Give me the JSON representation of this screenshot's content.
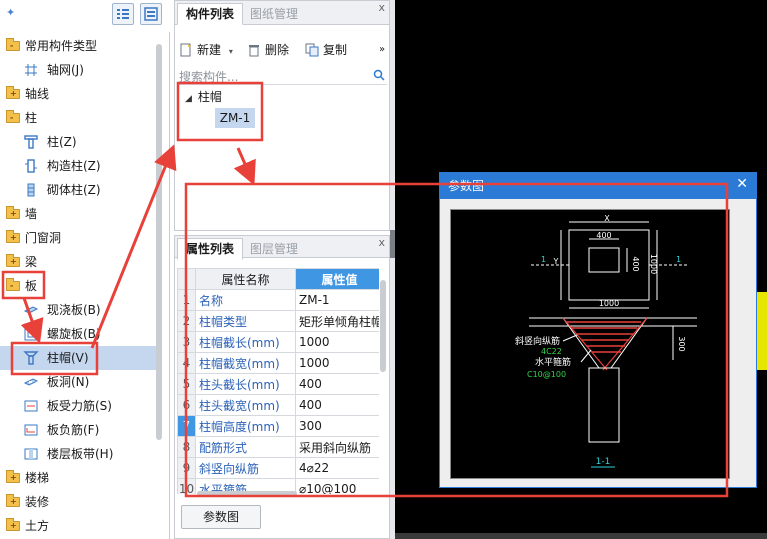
{
  "left_tree": {
    "items": [
      {
        "label": "常用构件类型",
        "kind": "folder",
        "mark": "-"
      },
      {
        "label": "轴网(J)",
        "kind": "child",
        "icon": "grid-axis-icon"
      },
      {
        "label": "轴线",
        "kind": "folder",
        "mark": "+"
      },
      {
        "label": "柱",
        "kind": "folder",
        "mark": "-"
      },
      {
        "label": "柱(Z)",
        "kind": "child",
        "icon": "column-icon"
      },
      {
        "label": "构造柱(Z)",
        "kind": "child",
        "icon": "structural-column-icon"
      },
      {
        "label": "砌体柱(Z)",
        "kind": "child",
        "icon": "masonry-column-icon"
      },
      {
        "label": "墙",
        "kind": "folder",
        "mark": "+"
      },
      {
        "label": "门窗洞",
        "kind": "folder",
        "mark": "+"
      },
      {
        "label": "梁",
        "kind": "folder",
        "mark": "+"
      },
      {
        "label": "板",
        "kind": "folder",
        "mark": "-"
      },
      {
        "label": "现浇板(B)",
        "kind": "child",
        "icon": "cast-slab-icon"
      },
      {
        "label": "螺旋板(B)",
        "kind": "child",
        "icon": "spiral-slab-icon"
      },
      {
        "label": "柱帽(V)",
        "kind": "child",
        "icon": "column-cap-icon",
        "selected": true
      },
      {
        "label": "板洞(N)",
        "kind": "child",
        "icon": "slab-hole-icon"
      },
      {
        "label": "板受力筋(S)",
        "kind": "child",
        "icon": "slab-rebar-icon"
      },
      {
        "label": "板负筋(F)",
        "kind": "child",
        "icon": "negative-rebar-icon"
      },
      {
        "label": "楼层板带(H)",
        "kind": "child",
        "icon": "floor-band-icon"
      },
      {
        "label": "楼梯",
        "kind": "folder",
        "mark": "+"
      },
      {
        "label": "装修",
        "kind": "folder",
        "mark": "+"
      },
      {
        "label": "土方",
        "kind": "folder",
        "mark": "+"
      }
    ]
  },
  "component_panel": {
    "tabs": [
      "构件列表",
      "图纸管理"
    ],
    "close": "x",
    "toolbar": {
      "new": "新建",
      "delete": "删除",
      "copy": "复制",
      "more": "»"
    },
    "search_placeholder": "搜索构件...",
    "tree": {
      "parent": "柱帽",
      "child": "ZM-1"
    }
  },
  "property_panel": {
    "tabs": [
      "属性列表",
      "图层管理"
    ],
    "close": "x",
    "columns": [
      "属性名称",
      "属性值"
    ],
    "rows": [
      {
        "n": "1",
        "name": "名称",
        "value": "ZM-1"
      },
      {
        "n": "2",
        "name": "柱帽类型",
        "value": "矩形单倾角柱帽"
      },
      {
        "n": "3",
        "name": "柱帽截长(mm)",
        "value": "1000"
      },
      {
        "n": "4",
        "name": "柱帽截宽(mm)",
        "value": "1000"
      },
      {
        "n": "5",
        "name": "柱头截长(mm)",
        "value": "400"
      },
      {
        "n": "6",
        "name": "柱头截宽(mm)",
        "value": "400"
      },
      {
        "n": "7",
        "name": "柱帽高度(mm)",
        "value": "300"
      },
      {
        "n": "8",
        "name": "配筋形式",
        "value": "采用斜向纵筋"
      },
      {
        "n": "9",
        "name": "斜竖向纵筋",
        "value": "4⌀22"
      },
      {
        "n": "10",
        "name": "水平箍筋",
        "value": "⌀10@100"
      }
    ],
    "param_button": "参数图"
  },
  "param_dialog": {
    "title": "参数图",
    "close": "✕",
    "drawing": {
      "dim_x": "X",
      "dim_y": "Y",
      "dim_400_top": "400",
      "dim_400_side": "400",
      "dim_1000_side": "1000",
      "dim_1000_bottom": "1000",
      "dim_300": "300",
      "section_mark_left": "1",
      "section_mark_right": "1",
      "label_slant": "斜竖向纵筋",
      "label_slant_value": "4C22",
      "label_horizontal": "水平箍筋",
      "label_horizontal_value": "C10@100",
      "section_name": "1-1"
    }
  },
  "colors": {
    "accent_blue": "#3f96e3",
    "dialog_title": "#2b7bd6",
    "annotation_red": "#e8413a",
    "drawing_green": "#34d24a",
    "drawing_cyan": "#2fd4d4"
  }
}
